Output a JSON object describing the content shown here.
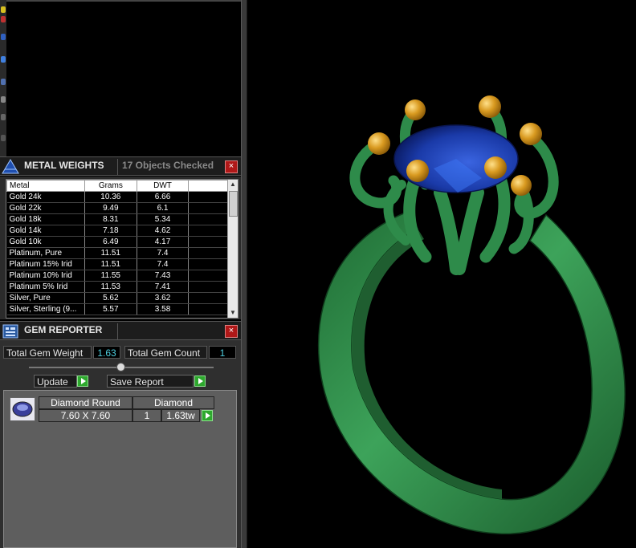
{
  "metal_weights": {
    "title": "METAL WEIGHTS",
    "status": "17 Objects Checked",
    "columns": [
      "Metal",
      "Grams",
      "DWT"
    ],
    "rows": [
      {
        "metal": "Gold 24k",
        "grams": "10.36",
        "dwt": "6.66"
      },
      {
        "metal": "Gold 22k",
        "grams": "9.49",
        "dwt": "6.1"
      },
      {
        "metal": "Gold 18k",
        "grams": "8.31",
        "dwt": "5.34"
      },
      {
        "metal": "Gold 14k",
        "grams": "7.18",
        "dwt": "4.62"
      },
      {
        "metal": "Gold 10k",
        "grams": "6.49",
        "dwt": "4.17"
      },
      {
        "metal": "Platinum, Pure",
        "grams": "11.51",
        "dwt": "7.4"
      },
      {
        "metal": "Platinum 15% Irid",
        "grams": "11.51",
        "dwt": "7.4"
      },
      {
        "metal": "Platinum 10% Irid",
        "grams": "11.55",
        "dwt": "7.43"
      },
      {
        "metal": "Platinum 5% Irid",
        "grams": "11.53",
        "dwt": "7.41"
      },
      {
        "metal": "Silver, Pure",
        "grams": "5.62",
        "dwt": "3.62"
      },
      {
        "metal": "Silver, Sterling (9...",
        "grams": "5.57",
        "dwt": "3.58"
      }
    ]
  },
  "gem_reporter": {
    "title": "GEM REPORTER",
    "total_weight_label": "Total Gem Weight",
    "total_weight_value": "1.63",
    "total_count_label": "Total Gem Count",
    "total_count_value": "1",
    "update_label": "Update",
    "save_report_label": "Save Report",
    "gem": {
      "name": "Diamond Round",
      "size": "7.60 X 7.60",
      "material": "Diamond",
      "count": "1",
      "weight": "1.63tw"
    }
  },
  "close_glyph": "×",
  "colors": {
    "ring_metal": "#2e8b4a",
    "prong_beads": "#d99a20",
    "stone": "#1a3aa8",
    "gem_value_text": "#4fd0e0",
    "go_button": "#2ea82e",
    "close_button": "#b01818"
  }
}
